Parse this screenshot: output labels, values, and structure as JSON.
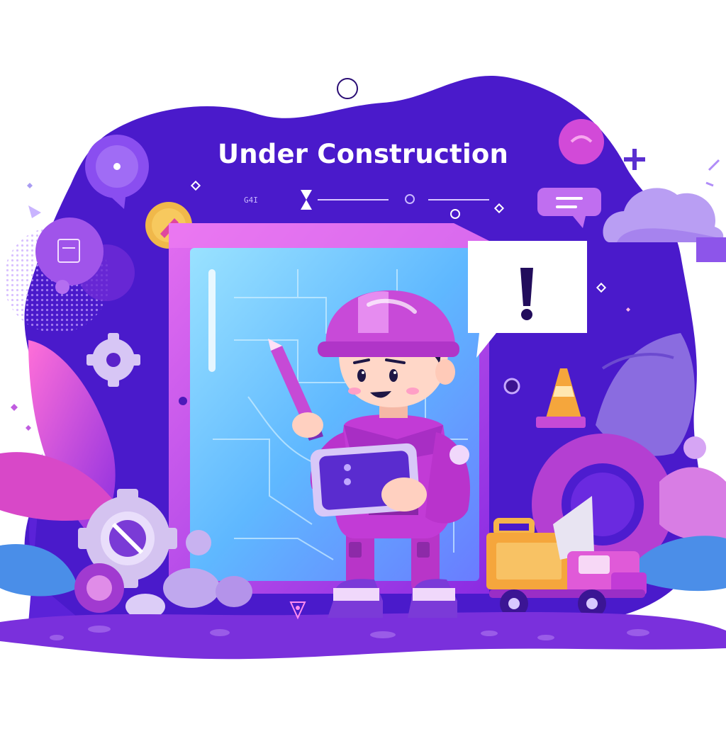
{
  "heading": {
    "text": "Under Construction"
  },
  "deco_text": {
    "left_label": "G4I"
  },
  "colors": {
    "background": "#ffffff",
    "blob": "#4d1ccf",
    "blob_edge": "#6a2af0",
    "magenta": "#c23bd6",
    "pink": "#e05ad8",
    "cyan_screen": "#7fd6ff",
    "orange": "#f5a63c",
    "lavender": "#b48cf2",
    "white": "#ffffff"
  },
  "icons": {
    "chat_bubble_left": "chat-bubble-icon",
    "chat_bubble_right": "message-icon",
    "alert_bubble": "exclamation-icon",
    "gear": "gear-icon",
    "cone": "traffic-cone-icon",
    "truck": "dump-truck-icon",
    "cloud": "cloud-icon",
    "pencil": "pencil-icon",
    "tablet": "tablet-icon",
    "pin": "location-pin-icon"
  }
}
